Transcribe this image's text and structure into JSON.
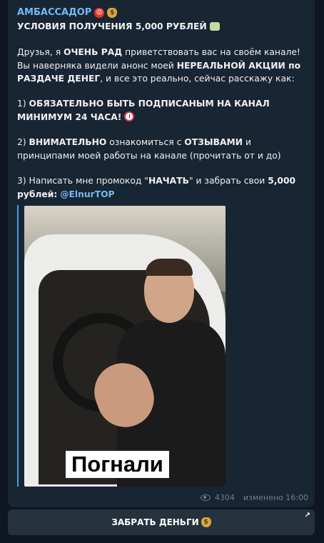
{
  "post": {
    "sender": "АМБАССАДОР",
    "title": "УСЛОВИЯ ПОЛУЧЕНИЯ 5,000 РУБЛЕЙ",
    "p1_a": "Друзья, я ",
    "p1_b": "ОЧЕНЬ РАД",
    "p1_c": " приветствовать вас на своём канале! Вы наверняка видели анонс моей ",
    "p1_d": "НЕРЕАЛЬНОЙ АКЦИИ по РАЗДАЧЕ ДЕНЕГ",
    "p1_e": ", и все это реально, сейчас расскажу как:",
    "item1_num": "1) ",
    "item1_text": "ОБЯЗАТЕЛЬНО БЫТЬ ПОДПИСАНЫМ НА КАНАЛ МИНИМУМ 24 ЧАСА!",
    "item2_num": "2) ",
    "item2_b1": "ВНИМАТЕЛЬНО",
    "item2_t1": " ознакомиться с ",
    "item2_b2": "ОТЗЫВАМИ",
    "item2_t2": " и принципами моей работы на канале (прочитать от и до)",
    "item3_a": "3) Написать мне промокод \"",
    "item3_b": "НАЧАТЬ",
    "item3_c": "\" и забрать свои ",
    "item3_d": "5,000 рублей:",
    "item3_link": "@ElnurTOP",
    "photo_caption": "Погнали",
    "views": "4304",
    "edited": "изменено 16:00"
  },
  "action_button": {
    "label": "ЗАБРАТЬ ДЕНЬГИ"
  },
  "icons": [
    "angry-face-icon",
    "money-bag-icon",
    "flying-money-icon",
    "alarm-clock-icon",
    "eye-icon",
    "external-arrow-icon"
  ],
  "colors": {
    "background": "#0e1621",
    "bubble": "#182533",
    "accent": "#71baf2",
    "button": "#25313d"
  }
}
